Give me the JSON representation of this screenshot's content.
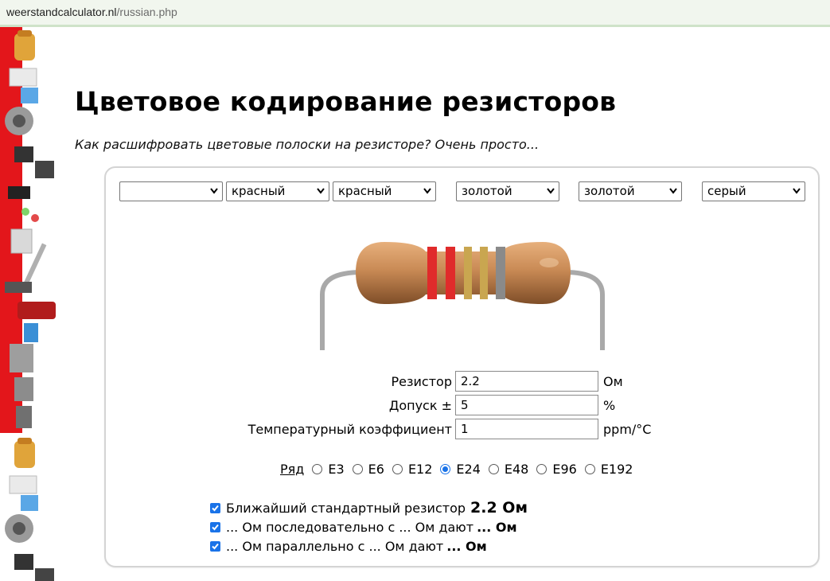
{
  "browser": {
    "url_host": "weerstandcalculator.nl",
    "url_path": "/russian.php"
  },
  "header": {
    "title": "Цветовое кодирование резисторов",
    "subtitle": "Как расшифровать цветовые полоски на резисторе? Очень просто..."
  },
  "bands": [
    {
      "value": ""
    },
    {
      "value": "красный"
    },
    {
      "value": "красный"
    },
    {
      "value": "золотой"
    },
    {
      "value": "золотой"
    },
    {
      "value": "серый"
    }
  ],
  "resistor": {
    "body_color": "#c98a55",
    "band_colors": [
      "#e02b2b",
      "#e02b2b",
      "#c9a650",
      "#c9a650",
      "#8a8a8a"
    ]
  },
  "fields": {
    "resistance": {
      "label": "Резистор",
      "value": "2.2",
      "unit": "Ом"
    },
    "tolerance": {
      "label": "Допуск ±",
      "value": "5",
      "unit": "%"
    },
    "tempco": {
      "label": "Температурный коэффициент",
      "value": "1",
      "unit": "ppm/°C"
    }
  },
  "series": {
    "label": "Ряд",
    "options": [
      "E3",
      "E6",
      "E12",
      "E24",
      "E48",
      "E96",
      "E192"
    ],
    "selected": "E24"
  },
  "checks": {
    "nearest": {
      "text": "Ближайший стандартный резистор ",
      "value": "2.2 Ом"
    },
    "serial": {
      "text": "... Ом последовательно с ... Ом дают ",
      "value": "... Ом"
    },
    "parallel": {
      "text": "... Ом параллельно с ... Ом дают ",
      "value": "... Ом"
    }
  },
  "colors": {
    "accent": "#1a73e8",
    "strip_red": "#e3161b"
  }
}
